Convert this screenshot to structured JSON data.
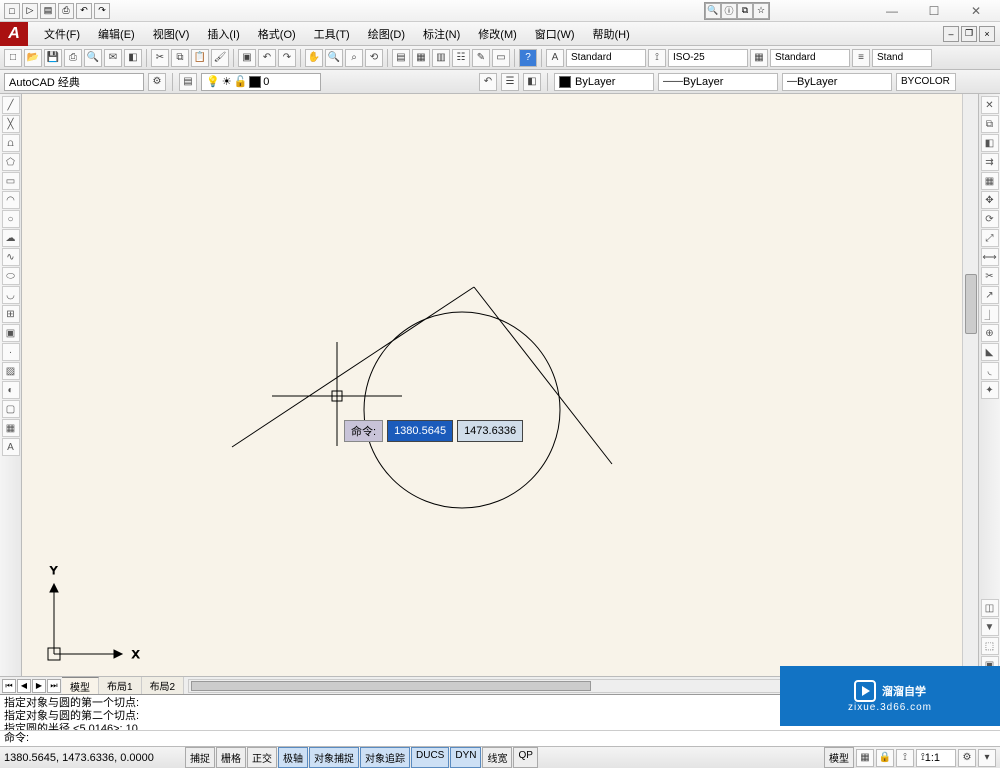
{
  "titlebar_quick": [
    "□",
    "▷",
    "▤",
    "⎙",
    "↶",
    "↷"
  ],
  "search_icons": [
    "🔍",
    "ⓘ",
    "⧉",
    "☆"
  ],
  "menus": [
    "文件(F)",
    "编辑(E)",
    "视图(V)",
    "插入(I)",
    "格式(O)",
    "工具(T)",
    "绘图(D)",
    "标注(N)",
    "修改(M)",
    "窗口(W)",
    "帮助(H)"
  ],
  "workspace": "AutoCAD 经典",
  "layer_name": "0",
  "styles": {
    "text": "Standard",
    "dim": "ISO-25",
    "table": "Standard",
    "multi": "Stand"
  },
  "bylayer": {
    "color": "ByLayer",
    "ltype": "ByLayer",
    "lweight": "ByLayer",
    "plot": "BYCOLOR"
  },
  "dyn": {
    "label": "命令:",
    "x": "1380.5645",
    "y": "1473.6336"
  },
  "tabs": {
    "model": "模型",
    "layout1": "布局1",
    "layout2": "布局2"
  },
  "cmd_hist": [
    "指定对象与圆的第一个切点:",
    "指定对象与圆的第二个切点:",
    "指定圆的半径 <5.0146>: 10"
  ],
  "cmd_prompt": "命令:",
  "status": {
    "coords": "1380.5645, 1473.6336, 0.0000",
    "toggles": [
      {
        "label": "捕捉",
        "on": false
      },
      {
        "label": "栅格",
        "on": false
      },
      {
        "label": "正交",
        "on": false
      },
      {
        "label": "极轴",
        "on": true
      },
      {
        "label": "对象捕捉",
        "on": true
      },
      {
        "label": "对象追踪",
        "on": true
      },
      {
        "label": "DUCS",
        "on": true
      },
      {
        "label": "DYN",
        "on": true
      },
      {
        "label": "线宽",
        "on": false
      },
      {
        "label": "QP",
        "on": false
      }
    ],
    "right_text": "模型",
    "scale": "1:1"
  },
  "watermark": {
    "title": "溜溜自学",
    "sub": "zixue.3d66.com"
  }
}
